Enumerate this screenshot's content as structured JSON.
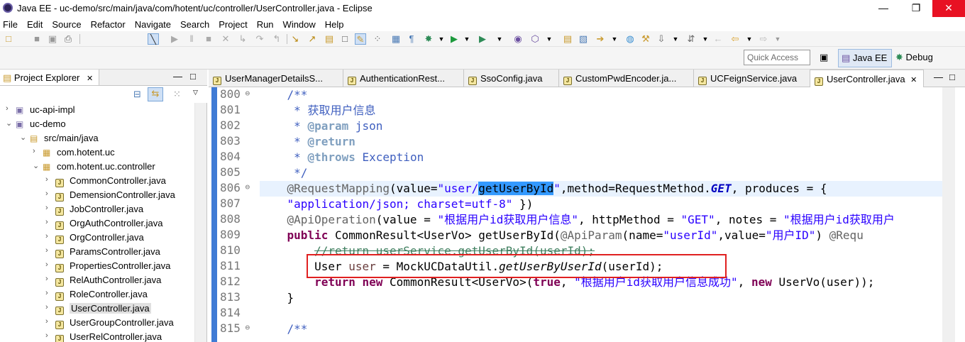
{
  "window": {
    "title": "Java EE - uc-demo/src/main/java/com/hotent/uc/controller/UserController.java - Eclipse",
    "minimize_icon": "minimize-icon",
    "maximize_icon": "maximize-icon",
    "close_icon": "close-icon"
  },
  "menu": [
    "File",
    "Edit",
    "Source",
    "Refactor",
    "Navigate",
    "Search",
    "Project",
    "Run",
    "Window",
    "Help"
  ],
  "perspective": {
    "quick_access_placeholder": "Quick Access",
    "java_ee_label": "Java EE",
    "debug_label": "Debug"
  },
  "project_explorer": {
    "title": "Project Explorer",
    "close_glyph": "✕",
    "tree": [
      {
        "label": "uc-api-impl",
        "arrow": "›",
        "icon": "project-icon"
      },
      {
        "label": "uc-demo",
        "arrow": "⌄",
        "icon": "project-icon"
      },
      {
        "label": "src/main/java",
        "arrow": "⌄",
        "icon": "source-folder-icon"
      },
      {
        "label": "com.hotent.uc",
        "arrow": "›",
        "icon": "package-icon"
      },
      {
        "label": "com.hotent.uc.controller",
        "arrow": "⌄",
        "icon": "package-icon"
      },
      {
        "label": "CommonController.java",
        "arrow": "›",
        "icon": "java-file-icon"
      },
      {
        "label": "DemensionController.java",
        "arrow": "›",
        "icon": "java-file-icon"
      },
      {
        "label": "JobController.java",
        "arrow": "›",
        "icon": "java-file-icon"
      },
      {
        "label": "OrgAuthController.java",
        "arrow": "›",
        "icon": "java-file-icon"
      },
      {
        "label": "OrgController.java",
        "arrow": "›",
        "icon": "java-file-icon"
      },
      {
        "label": "ParamsController.java",
        "arrow": "›",
        "icon": "java-file-icon"
      },
      {
        "label": "PropertiesController.java",
        "arrow": "›",
        "icon": "java-file-icon"
      },
      {
        "label": "RelAuthController.java",
        "arrow": "›",
        "icon": "java-file-icon"
      },
      {
        "label": "RoleController.java",
        "arrow": "›",
        "icon": "java-file-icon"
      },
      {
        "label": "UserController.java",
        "arrow": "›",
        "icon": "java-file-icon",
        "selected": true
      },
      {
        "label": "UserGroupController.java",
        "arrow": "›",
        "icon": "java-file-icon"
      },
      {
        "label": "UserRelController.java",
        "arrow": "›",
        "icon": "java-file-icon"
      }
    ]
  },
  "editor": {
    "tabs": [
      {
        "label": "UserManagerDetailsS..."
      },
      {
        "label": "AuthenticationRest..."
      },
      {
        "label": "SsoConfig.java"
      },
      {
        "label": "CustomPwdEncoder.ja..."
      },
      {
        "label": "UCFeignService.java"
      },
      {
        "label": "UserController.java",
        "active": true,
        "close": "✕"
      }
    ],
    "line_numbers": [
      "800",
      "801",
      "802",
      "803",
      "804",
      "805",
      "806",
      "807",
      "808",
      "809",
      "810",
      "811",
      "812",
      "813",
      "814",
      "815"
    ],
    "code": {
      "l800": "    /**",
      "l801a": "     * ",
      "l801b": "获取用户信息",
      "l802a": "     * ",
      "l802b": "@param",
      "l802c": " json",
      "l803a": "     * ",
      "l803b": "@return",
      "l804a": "     * ",
      "l804b": "@throws",
      "l804c": " Exception",
      "l805": "     */",
      "l806a": "    @RequestMapping",
      "l806b": "(value=",
      "l806c": "\"user/",
      "l806d": "getUserById",
      "l806e": "\"",
      "l806f": ",method=RequestMethod.",
      "l806g": "GET",
      "l806h": ", produces = {",
      "l807a": "    ",
      "l807b": "\"application/json; charset=utf-8\"",
      "l807c": " })",
      "l808a": "    @ApiOperation",
      "l808b": "(value = ",
      "l808c": "\"根据用户id获取用户信息\"",
      "l808d": ", httpMethod = ",
      "l808e": "\"GET\"",
      "l808f": ", notes = ",
      "l808g": "\"根据用户id获取用户",
      "l809a": "    ",
      "l809b": "public",
      "l809c": " CommonResult<UserVo> getUserById(",
      "l809d": "@ApiParam",
      "l809e": "(name=",
      "l809f": "\"userId\"",
      "l809g": ",value=",
      "l809h": "\"用户ID\"",
      "l809i": ") ",
      "l809j": "@Requ",
      "l810a": "        ",
      "l810b": "//return userService.getUserById(userId);",
      "l811a": "        User ",
      "l811b": "user",
      "l811c": " = MockUCDataUtil.",
      "l811d": "getUserByUserId",
      "l811e": "(userId);",
      "l812a": "        ",
      "l812b": "return",
      "l812c": " ",
      "l812d": "new",
      "l812e": " CommonResult<UserVo>(",
      "l812f": "true",
      "l812g": ", ",
      "l812h": "\"根据用户id获取用户信息成功\"",
      "l812i": ", ",
      "l812j": "new",
      "l812k": " UserVo(user));",
      "l813": "    }",
      "l814": "",
      "l815": "    /**"
    }
  },
  "colors": {
    "keyword": "#7f0055",
    "string": "#2a00ff",
    "javadoc": "#3f5fbf",
    "annotation": "#646464",
    "selection": "#3399ff",
    "current_line": "#e8f2fe",
    "highlight_box": "#e02020"
  }
}
